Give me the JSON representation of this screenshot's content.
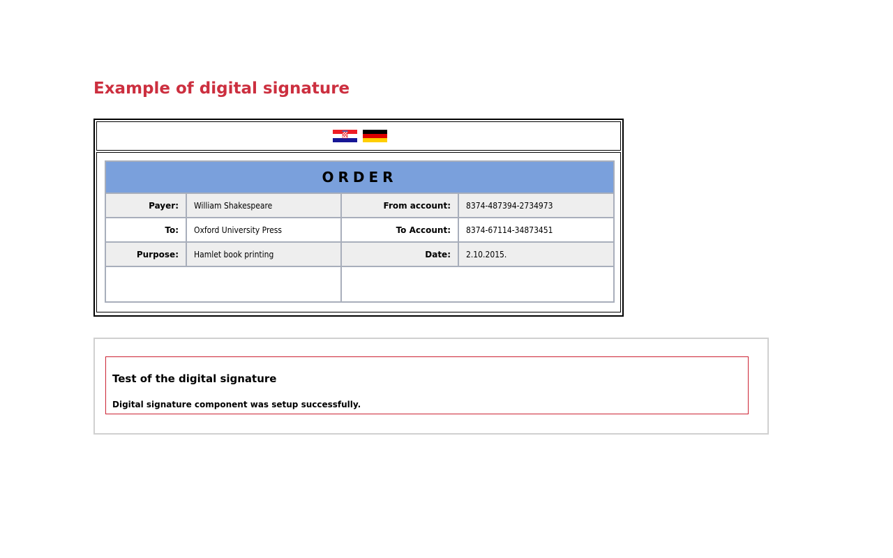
{
  "page": {
    "title": "Example of digital signature",
    "title_color": "#cc2f3f"
  },
  "languages": [
    {
      "name": "Croatian",
      "icon": "flag-croatia-icon"
    },
    {
      "name": "German",
      "icon": "flag-germany-icon"
    }
  ],
  "order": {
    "header": "ORDER",
    "header_color": "#7aa0dc",
    "rows": [
      {
        "label1": "Payer:",
        "value1": "William Shakespeare",
        "label2": "From account:",
        "value2": "8374-487394-2734973"
      },
      {
        "label1": "To:",
        "value1": "Oxford University Press",
        "label2": "To Account:",
        "value2": "8374-67114-34873451"
      },
      {
        "label1": "Purpose:",
        "value1": "Hamlet book printing",
        "label2": "Date:",
        "value2": "2.10.2015."
      }
    ]
  },
  "signature": {
    "title": "Test of the digital signature",
    "message": "Digital signature component was setup successfully.",
    "border_color": "#cc2233"
  }
}
